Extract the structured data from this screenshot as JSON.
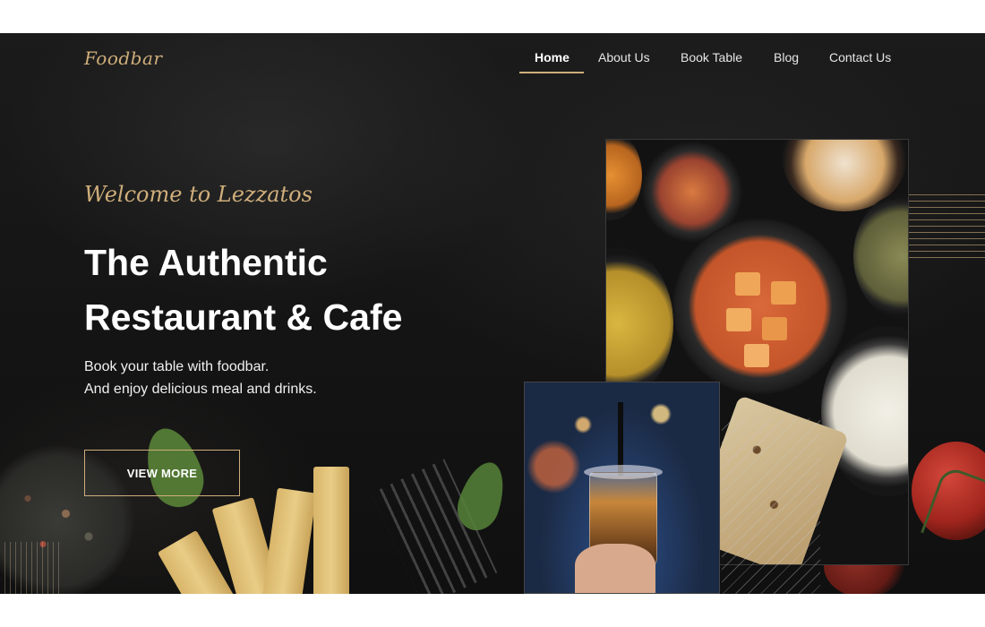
{
  "brand": {
    "logo_text": "Foodbar"
  },
  "nav": {
    "items": [
      {
        "label": "Home",
        "active": true
      },
      {
        "label": "About Us",
        "active": false
      },
      {
        "label": "Book Table",
        "active": false
      },
      {
        "label": "Blog",
        "active": false
      },
      {
        "label": "Contact Us",
        "active": false
      }
    ]
  },
  "hero": {
    "welcome": "Welcome to Lezzatos",
    "headline_line1": "The Authentic",
    "headline_line2": "Restaurant & Cafe",
    "sub_line1": "Book your table with foodbar.",
    "sub_line2": "And enjoy delicious meal and drinks.",
    "cta_label": "VIEW MORE"
  },
  "colors": {
    "accent": "#cfae7b",
    "background": "#151515",
    "text": "#ffffff"
  }
}
